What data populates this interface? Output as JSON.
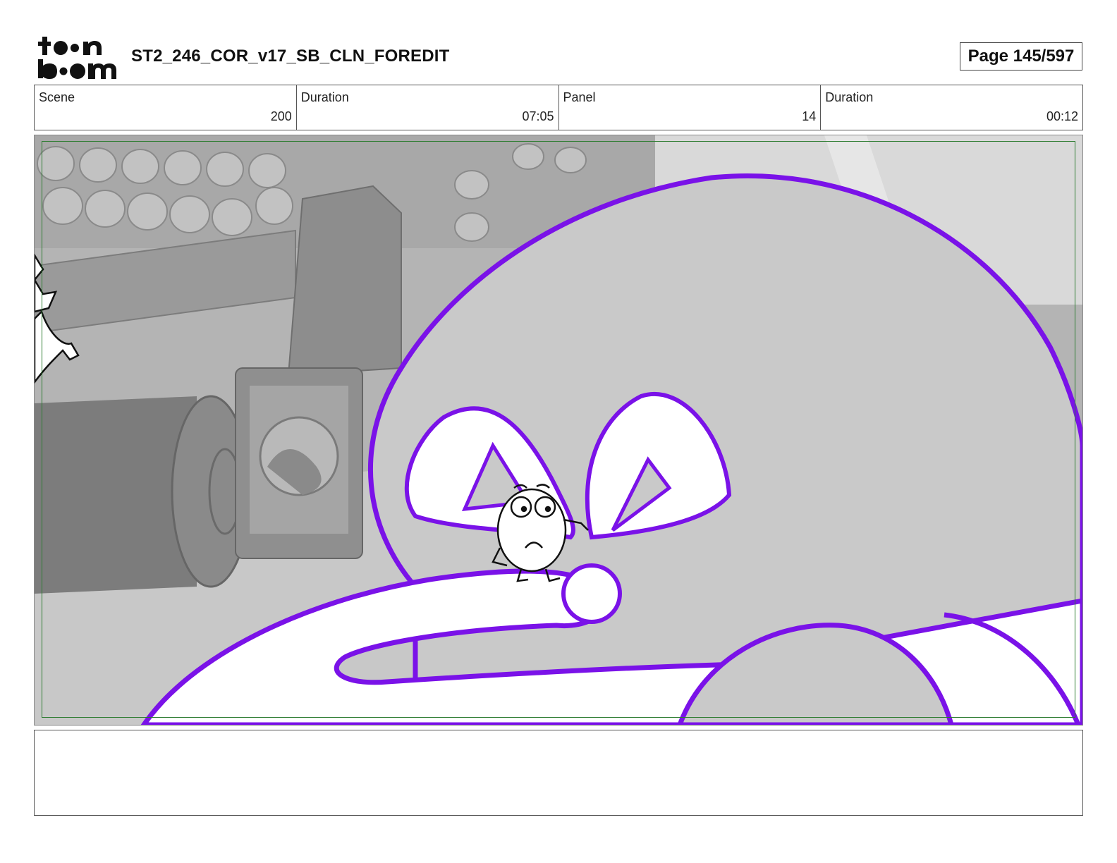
{
  "header": {
    "logo_alt": "toon boom",
    "title": "ST2_246_COR_v17_SB_CLN_FOREDIT",
    "page": "Page 145/597"
  },
  "info": [
    {
      "label": "Scene",
      "value": "200"
    },
    {
      "label": "Duration",
      "value": "07:05"
    },
    {
      "label": "Panel",
      "value": "14"
    },
    {
      "label": "Duration",
      "value": "00:12"
    }
  ],
  "panel": {
    "outline_color": "#7a12e8",
    "safe_frame_color": "#2e7d32",
    "background_tone": "#bdbdbd"
  },
  "notes": {
    "text": ""
  }
}
